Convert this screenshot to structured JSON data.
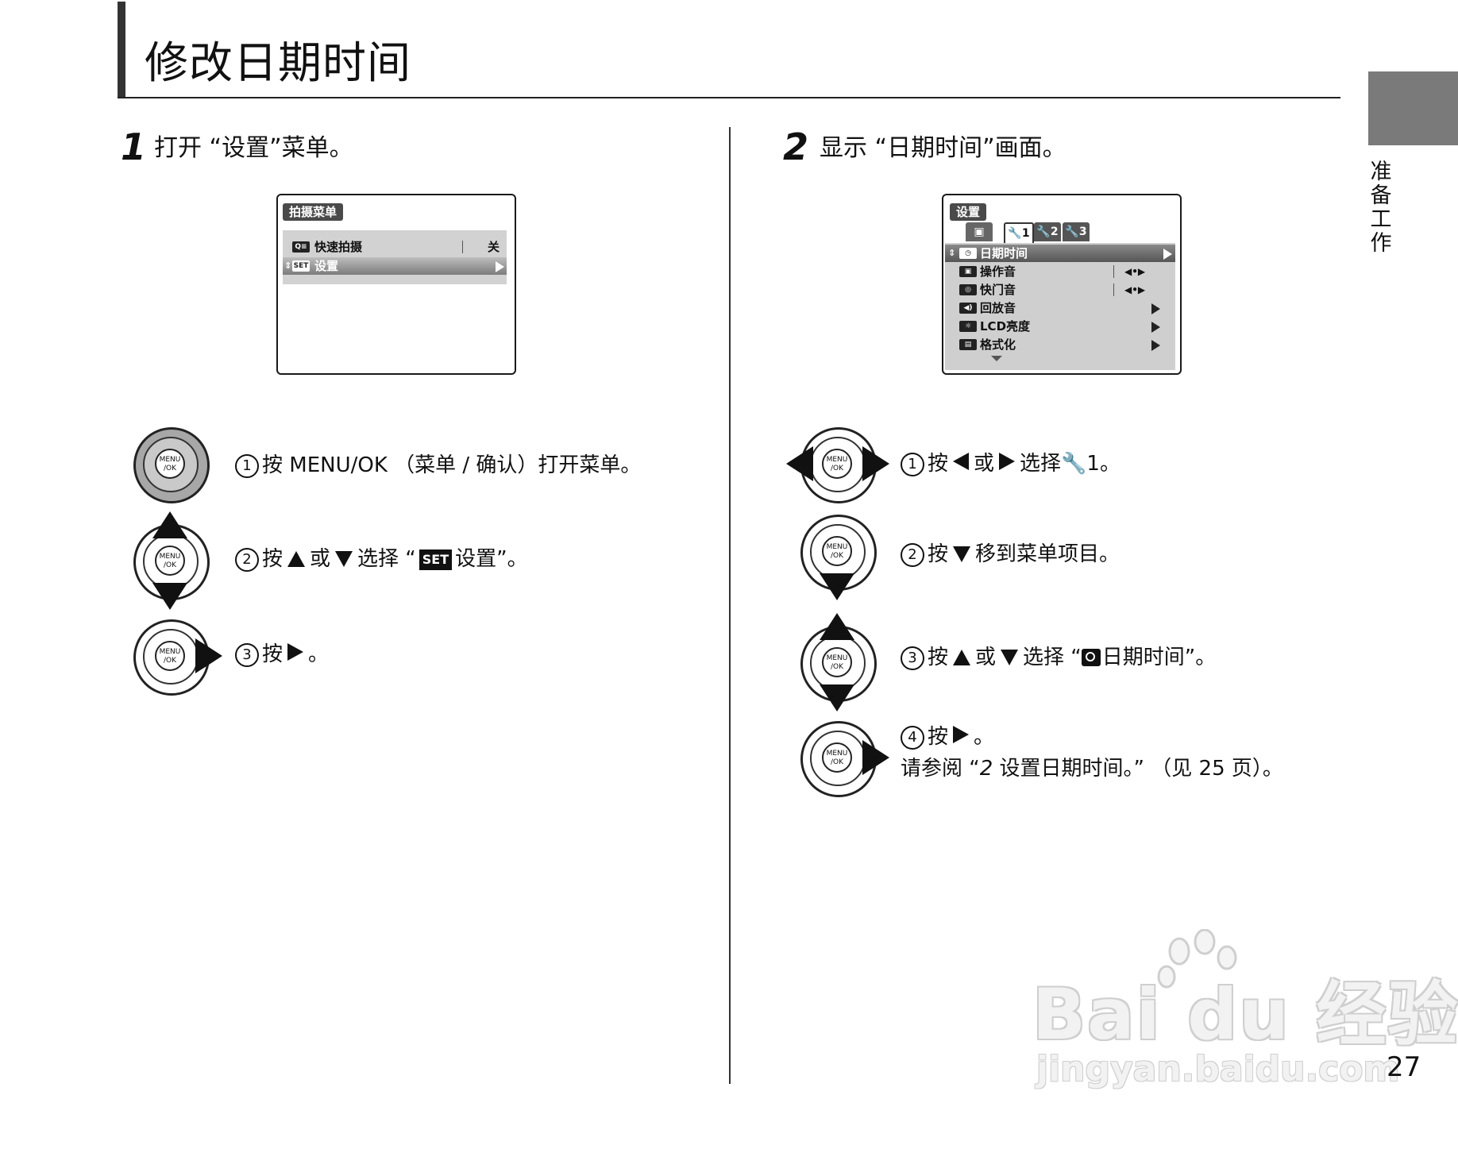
{
  "page": {
    "title": "修改日期时间",
    "side_tab_label": [
      "准",
      "备",
      "工",
      "作"
    ],
    "page_number": "27"
  },
  "step1": {
    "number": "1",
    "heading": "打开 “设置”菜单。",
    "lcd": {
      "menu_title": "拍摄菜单",
      "rows": [
        {
          "icon": "quick-shoot-icon",
          "icon_text": "Q≡",
          "label": "快速拍摄",
          "value": "关"
        },
        {
          "icon": "set-icon",
          "icon_text": "SET",
          "label": "设置"
        }
      ]
    },
    "instructions": [
      {
        "num": "1",
        "parts": [
          "按 MENU/OK （菜单 / 确认）打开菜单。"
        ]
      },
      {
        "num": "2",
        "parts": [
          "按",
          "或",
          "选择 “",
          "设置”。"
        ],
        "set_label": "SET"
      },
      {
        "num": "3",
        "parts": [
          "按",
          "。"
        ]
      }
    ]
  },
  "step2": {
    "number": "2",
    "heading": "显示 “日期时间”画面。",
    "lcd": {
      "menu_title": "设置",
      "tabs": [
        "1",
        "2",
        "3"
      ],
      "rows": [
        {
          "icon": "clock-icon",
          "icon_text": "◷",
          "label": "日期时间"
        },
        {
          "icon": "operation-sound-icon",
          "icon_text": "▣",
          "label": "操作音",
          "value": "◀•▶"
        },
        {
          "icon": "shutter-sound-icon",
          "icon_text": "◎",
          "label": "快门音",
          "value": "◀•▶"
        },
        {
          "icon": "playback-sound-icon",
          "icon_text": "◀)",
          "label": "回放音"
        },
        {
          "icon": "lcd-brightness-icon",
          "icon_text": "☼",
          "label": "LCD亮度"
        },
        {
          "icon": "format-icon",
          "icon_text": "▤",
          "label": "格式化"
        }
      ]
    },
    "instructions": [
      {
        "num": "1",
        "parts": [
          "按",
          "或",
          "选择",
          "1。"
        ]
      },
      {
        "num": "2",
        "parts": [
          "按",
          "移到菜单项目。"
        ]
      },
      {
        "num": "3",
        "parts": [
          "按",
          "或",
          "选择 “",
          "日期时间”。"
        ]
      },
      {
        "num": "4",
        "parts": [
          "按",
          "。"
        ],
        "note": [
          "请参阅 “",
          "2",
          " 设置日期时间。” （见 25 页）。"
        ]
      }
    ]
  },
  "dpad": {
    "button_label_1": "MENU",
    "button_label_2": "/OK"
  },
  "watermark": {
    "brand": "Bai du 经验",
    "url": "jingyan.baidu.com"
  }
}
